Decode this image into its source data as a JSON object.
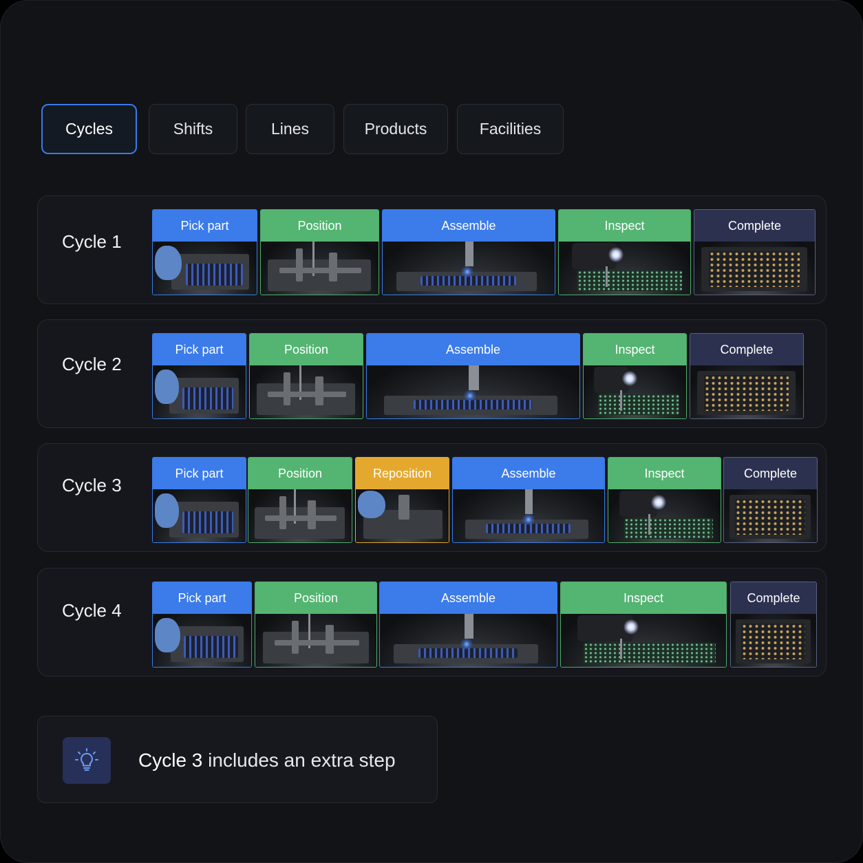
{
  "tabs": [
    {
      "label": "Cycles",
      "active": true
    },
    {
      "label": "Shifts",
      "active": false
    },
    {
      "label": "Lines",
      "active": false
    },
    {
      "label": "Products",
      "active": false
    },
    {
      "label": "Facilities",
      "active": false
    }
  ],
  "cycles": [
    {
      "label": "Cycle 1",
      "steps": [
        {
          "label": "Pick part",
          "kind": "pick"
        },
        {
          "label": "Position",
          "kind": "position"
        },
        {
          "label": "Assemble",
          "kind": "assemble"
        },
        {
          "label": "Inspect",
          "kind": "inspect"
        },
        {
          "label": "Complete",
          "kind": "complete"
        }
      ]
    },
    {
      "label": "Cycle 2",
      "steps": [
        {
          "label": "Pick part",
          "kind": "pick"
        },
        {
          "label": "Position",
          "kind": "position"
        },
        {
          "label": "Assemble",
          "kind": "assemble"
        },
        {
          "label": "Inspect",
          "kind": "inspect"
        },
        {
          "label": "Complete",
          "kind": "complete"
        }
      ]
    },
    {
      "label": "Cycle 3",
      "steps": [
        {
          "label": "Pick part",
          "kind": "pick"
        },
        {
          "label": "Position",
          "kind": "position"
        },
        {
          "label": "Reposition",
          "kind": "reposition"
        },
        {
          "label": "Assemble",
          "kind": "assemble"
        },
        {
          "label": "Inspect",
          "kind": "inspect"
        },
        {
          "label": "Complete",
          "kind": "complete"
        }
      ]
    },
    {
      "label": "Cycle 4",
      "steps": [
        {
          "label": "Pick part",
          "kind": "pick"
        },
        {
          "label": "Position",
          "kind": "position"
        },
        {
          "label": "Assemble",
          "kind": "assemble"
        },
        {
          "label": "Inspect",
          "kind": "inspect"
        },
        {
          "label": "Complete",
          "kind": "complete"
        }
      ]
    }
  ],
  "insight": {
    "icon": "lightbulb-icon",
    "highlight": "Cycle 3",
    "text": " includes an extra step"
  },
  "colors": {
    "accent_blue": "#3b7bea",
    "step_green": "#54b472",
    "step_orange": "#e5a82e",
    "step_navy": "#2d3150"
  }
}
